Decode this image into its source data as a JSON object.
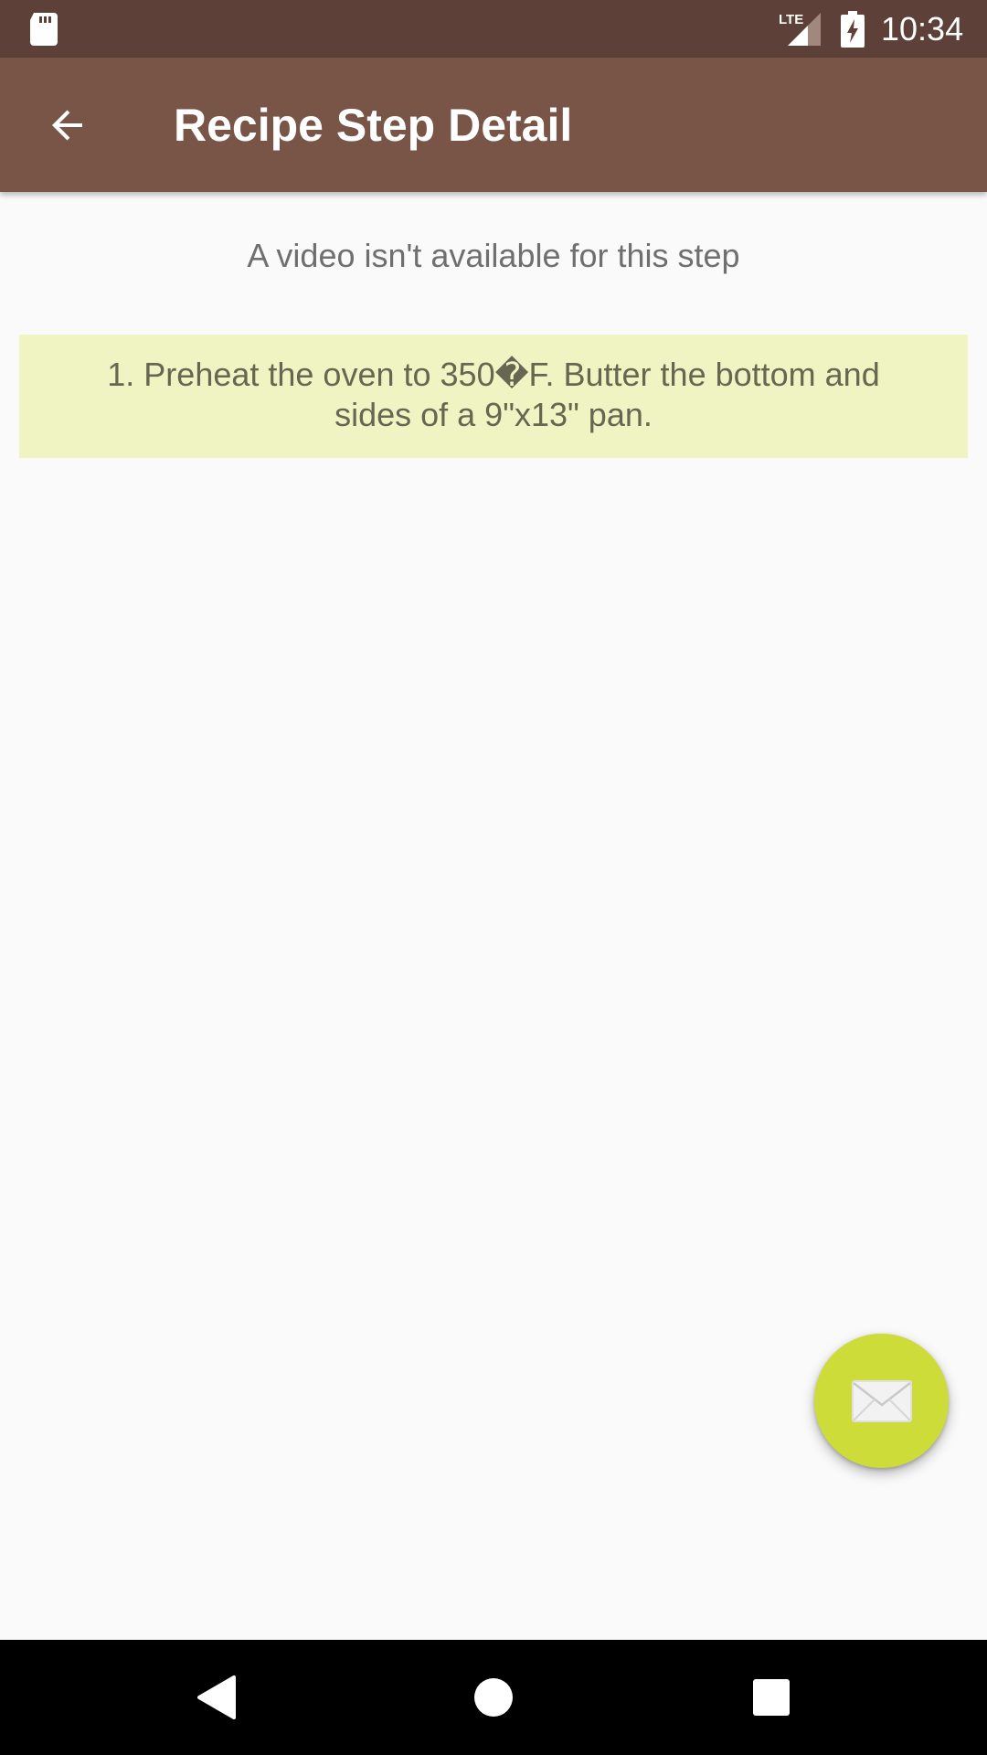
{
  "status_bar": {
    "network_label": "LTE",
    "time": "10:34",
    "icons": [
      "sd-card-icon",
      "lte-signal-icon",
      "battery-charging-icon"
    ]
  },
  "app_bar": {
    "title": "Recipe Step Detail",
    "back_icon": "arrow-back-icon"
  },
  "main": {
    "no_video_message": "A video isn't available for this step",
    "step_description_line1": "1. Preheat the oven to 350�F. Butter the bottom and",
    "step_description_line2": "sides of a 9\"x13\" pan."
  },
  "fab": {
    "icon": "envelope-icon"
  },
  "nav_bar": {
    "icons": [
      "back-triangle-icon",
      "home-circle-icon",
      "recents-square-icon"
    ]
  },
  "colors": {
    "status_bar": "#5d4037",
    "app_bar": "#795548",
    "step_card": "#f0f4c3",
    "fab": "#cddc39",
    "background": "#fafafa"
  }
}
